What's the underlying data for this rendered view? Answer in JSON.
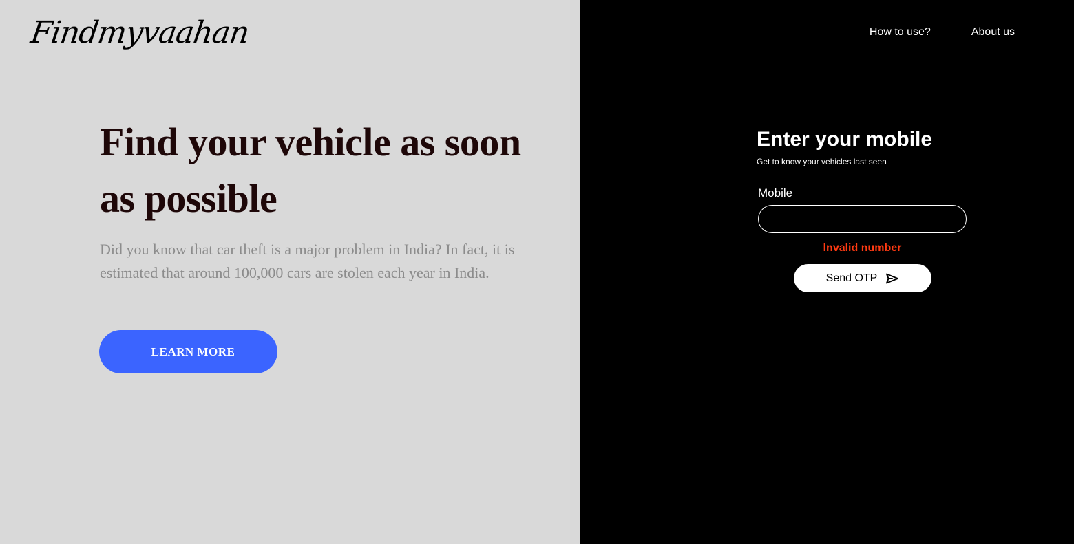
{
  "brand": {
    "logo": "Findmyvaahan"
  },
  "nav": {
    "how_to_use": "How to use?",
    "about_us": "About us"
  },
  "hero": {
    "title": "Find your vehicle as soon as possible",
    "description": "Did you know that car theft is a major problem in India? In fact, it is estimated that around 100,000 cars are stolen each year in India.",
    "learn_more_label": "LEARN MORE"
  },
  "form": {
    "title": "Enter your mobile",
    "subtitle": "Get to know your vehicles last seen",
    "mobile_label": "Mobile",
    "mobile_value": "",
    "error": "Invalid number",
    "send_label": "Send OTP",
    "send_icon": "send-icon"
  },
  "colors": {
    "left_bg": "#d9d9d9",
    "right_bg": "#000000",
    "accent": "#3b64ff",
    "error": "#ff3a12",
    "title": "#1e0708"
  }
}
